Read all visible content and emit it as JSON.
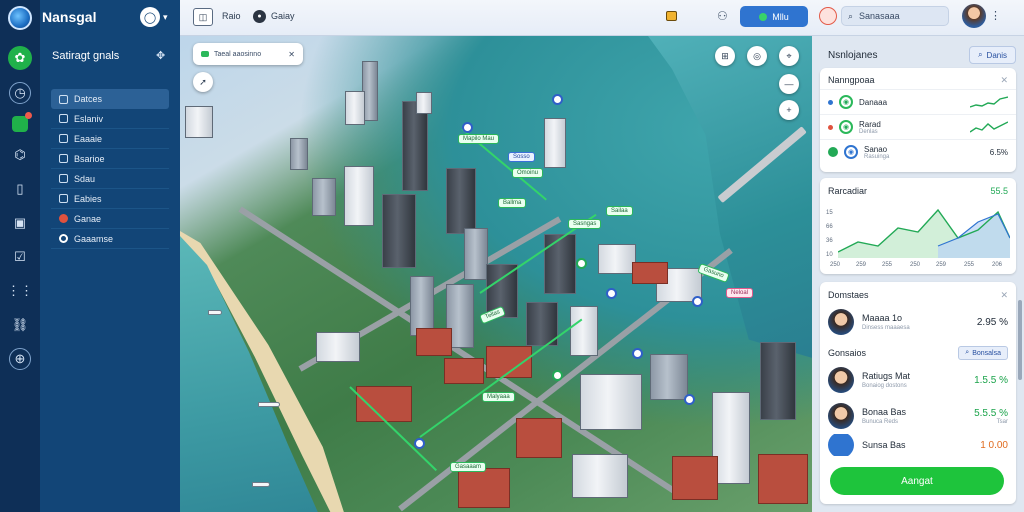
{
  "app": {
    "title": "Nansgal"
  },
  "rail": {
    "icons": [
      "globe-icon",
      "leaf-icon",
      "clock-icon",
      "chat-icon",
      "chart-icon",
      "file-icon",
      "box-icon",
      "check-icon",
      "grid-icon",
      "link-icon",
      "globe-settings-icon"
    ]
  },
  "sidebar": {
    "heading": "Satiragt gnals",
    "items": [
      {
        "label": "Datces"
      },
      {
        "label": "Eslaniv"
      },
      {
        "label": "Eaaaie"
      },
      {
        "label": "Bsarioe"
      },
      {
        "label": "Sdau"
      },
      {
        "label": "Eabies"
      },
      {
        "label": "Ganae"
      },
      {
        "label": "Gaaamse"
      }
    ]
  },
  "topbar": {
    "item_a": "Raio",
    "item_b": "Gaiay",
    "pill_label": "Mllu",
    "search_placeholder": "Sanasaaa"
  },
  "map": {
    "search_text": "Taeal aaosinno",
    "labels": [
      "Mapilo Mau",
      "Sosso",
      "Omoinu",
      "Ballma",
      "Sailaa",
      "Sasngas",
      "Gasuno",
      "Neloal",
      "Tellas",
      "Malyaaa",
      "Gasaaam"
    ]
  },
  "panel": {
    "header_title": "Nsnlojanes",
    "header_button": "Danis",
    "metrics": {
      "title": "Nanngpoaa",
      "rows": [
        {
          "label": "Danaaa",
          "value": ""
        },
        {
          "label": "Rarad",
          "sub": "Denlas",
          "value": ""
        },
        {
          "label": "Sanao",
          "sub": "Rasuinga",
          "value": "6.5%"
        }
      ]
    },
    "performance": {
      "title": "Rarcadiar",
      "value": "55.5",
      "y_ticks": [
        "15",
        "66",
        "36",
        "10"
      ],
      "x_ticks": [
        "250",
        "259",
        "255",
        "250",
        "259",
        "255",
        "206"
      ]
    },
    "drivers": {
      "title": "Domstaes",
      "rows": [
        {
          "name": "Maaaa 1o",
          "sub": "Dinsess maaaesa",
          "amount": "2.95 %",
          "amount_sub": ""
        }
      ]
    },
    "quotes": {
      "title": "Gonsaios",
      "button": "Bonsalsa",
      "rows": [
        {
          "name": "Ratiugs Mat",
          "sub": "Bonaiog dostons",
          "amount": "1.5.5 %",
          "amount_sub": ""
        },
        {
          "name": "Bonaa Bas",
          "sub": "Bunuca Reds",
          "amount": "5.5.5 %",
          "amount_sub": "Tsar"
        },
        {
          "name": "Sunsa Bas",
          "sub": "",
          "amount": "1 0.00",
          "amount_sub": ""
        }
      ]
    },
    "cta": "Aangat"
  },
  "colors": {
    "accent": "#1ec43c",
    "brand": "#124577",
    "primary": "#2f74d0"
  }
}
